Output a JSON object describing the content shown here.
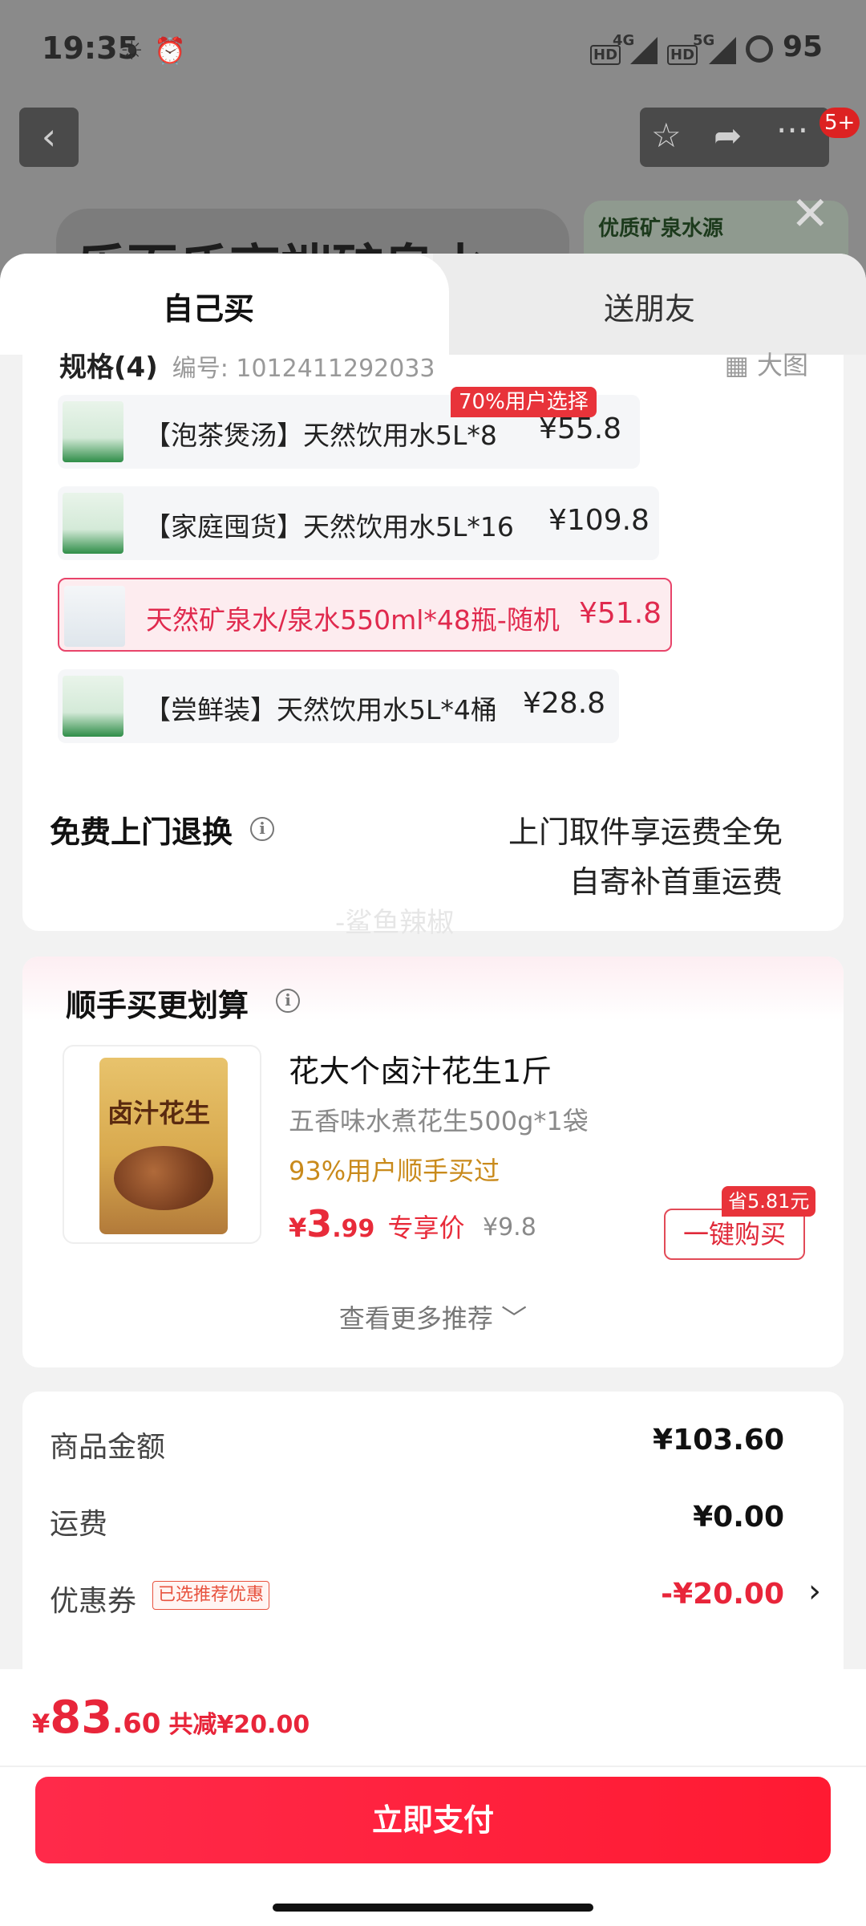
{
  "status_bar": {
    "time": "19:35",
    "net1": "4G",
    "net2": "5G",
    "hd": "HD",
    "battery": "95"
  },
  "background": {
    "badge": "5+",
    "title_partial": "乐百氏高端矿泉水",
    "card_text": "优质矿泉水源"
  },
  "tabs": {
    "self": "自己买",
    "gift": "送朋友"
  },
  "spec": {
    "heading": "规格(4)",
    "code": "编号: 1012411292033",
    "big_view": "大图"
  },
  "options": [
    {
      "text": "【泡茶煲汤】天然饮用水5L*8",
      "price": "¥55.8",
      "tag": "70%用户选择"
    },
    {
      "text": "【家庭囤货】天然饮用水5L*16",
      "price": "¥109.8"
    },
    {
      "text": "天然矿泉水/泉水550ml*48瓶-随机",
      "price": "¥51.8",
      "selected": true
    },
    {
      "text": "【尝鲜装】天然饮用水5L*4桶",
      "price": "¥28.8"
    }
  ],
  "returns": {
    "label": "免费上门退换",
    "line1": "上门取件享运费全免",
    "line2": "自寄补首重运费",
    "watermark": "-鲨鱼辣椒"
  },
  "bundle": {
    "title": "顺手买更划算",
    "product": {
      "image_text": "卤汁花生",
      "name": "花大个卤汁花生1斤",
      "sub": "五香味水煮花生500g*1袋",
      "popularity": "93%用户顺手买过",
      "price_yen": "¥",
      "price_int": "3",
      "price_dec": ".99",
      "price_label": "专享价",
      "orig_price": "¥9.8",
      "save_tag": "省5.81元",
      "buy_label": "一键购买"
    },
    "more": "查看更多推荐 ﹀"
  },
  "summary": {
    "goods_label": "商品金额",
    "goods_value": "¥103.60",
    "ship_label": "运费",
    "ship_value": "¥0.00",
    "coupon_label": "优惠券",
    "coupon_tag": "已选推荐优惠",
    "coupon_value": "-¥20.00"
  },
  "footer": {
    "total_yen": "¥",
    "total_int": "83",
    "total_dec": ".60",
    "reduced": "共减¥20.00",
    "pay_label": "立即支付"
  },
  "colors": {
    "accent": "#ff1a32",
    "price_red": "#e8253a",
    "popularity": "#c98a1b"
  }
}
